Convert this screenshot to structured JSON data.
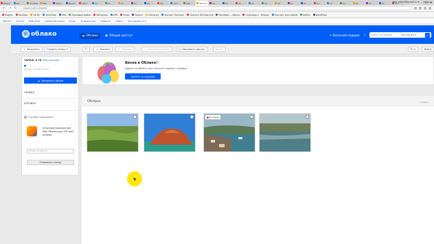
{
  "browser": {
    "tabs": [
      "Видео",
      "Ди",
      "YouTube",
      "Mail",
      "Мирн",
      "Видео",
      "Кино",
      "Ок",
      "Ок",
      "Ок",
      "Ок",
      "Ок",
      "Yan",
      "mail",
      "Mail",
      "Облако",
      "Ок",
      "Ок",
      "Ок",
      "Ок",
      "Ок",
      "Ок",
      "Ок",
      "Ок",
      "Ок",
      "Ок",
      "Ок",
      "Ок",
      "Ок",
      "Ок",
      "Ок"
    ],
    "active_tab_index": 15,
    "url": "cloud.mail.ru/home/",
    "window_controls": [
      "–",
      "□",
      "✕"
    ]
  },
  "bookmarks": [
    {
      "label": "Яндекс",
      "color": "#e53935"
    },
    {
      "label": "YouTube",
      "color": "#e53935"
    },
    {
      "label": "ОК.RU",
      "color": "#ff9800"
    },
    {
      "label": "VimeTube",
      "color": "#1e88e5"
    },
    {
      "label": "Mail",
      "color": "#1565c0"
    },
    {
      "label": "Красивые майки",
      "color": "#43a047"
    },
    {
      "label": "AliExpress",
      "color": "#e53935"
    },
    {
      "label": "ePN",
      "color": "#1e88e5"
    },
    {
      "label": "Gmail",
      "color": "#e53935"
    },
    {
      "label": "Трансл",
      "color": "#8e24aa"
    },
    {
      "label": "CSmoney",
      "color": "#fbc02d"
    },
    {
      "label": "Хостинг Пинчинг",
      "color": "#1e88e5"
    },
    {
      "label": "Скачать YouTube в ф",
      "color": "#e53935"
    },
    {
      "label": "Facebook — Выпол",
      "color": "#3b5998"
    },
    {
      "label": "Страница 2 - Яндекс",
      "color": "#e53935"
    },
    {
      "label": "Хостинг для сайтов",
      "color": "#1e88e5"
    },
    {
      "label": "Войти",
      "color": "#43a047"
    },
    {
      "label": "WordPress",
      "color": "#455a64"
    }
  ],
  "portal": {
    "links": [
      "Mail.Ru",
      "Почта",
      "Мой Мир",
      "Одноклассники",
      "Игры",
      "Знакомства",
      "Новости",
      "Поиск",
      "Все проекты ▾"
    ],
    "user": "den_yurev@gmail.ru ▾",
    "exit": "выход"
  },
  "header": {
    "logo": "облако",
    "nav": [
      {
        "label": "Облако",
        "active": true
      },
      {
        "label": "Общий доступ",
        "active": false
      }
    ],
    "gifts": "Весенний подарок",
    "help": "?",
    "search_placeholder": "Поиск по Облаку",
    "search_scope": "Все папки ▾"
  },
  "toolbar": {
    "upload": "Загрузить",
    "create_folder": "Создать папку",
    "download": "Скачать",
    "delete": "Удалить",
    "get_link": "Получить ссылку",
    "access": "Настроить доступ",
    "more": "Ещё ▾",
    "sort": "▾",
    "view": "Вид ▾"
  },
  "sidebar": {
    "tariff": "ТАРИФ: 8 ГБ,",
    "tariff_type": "Бесплатный",
    "used": "Занято 1.46 ГБ из 8 ГБ",
    "expand_button": "Увеличить объем",
    "folders": [
      "ОБЛАКО",
      "КОРЗИНА"
    ],
    "support": "Служба поддержки",
    "app_text": "Установи приложение Mail Облако для iOS или Android",
    "phone_placeholder": "Номер телефона",
    "send_button": "Отправить ссылку"
  },
  "promo": {
    "title": "Весна в Облаке!",
    "subtitle": "Дарим гигабайты при покупке годовых тарифов",
    "button": "Купить со скидкой"
  },
  "content": {
    "breadcrumb": "Облако",
    "count": "4 файла",
    "shared_label": "Пошарен"
  },
  "colors": {
    "brand": "#005ff9",
    "toolbar_bg": "#f0f0f0",
    "page_bg": "#e9e9e9",
    "cursor_highlight": "#ffe600"
  }
}
